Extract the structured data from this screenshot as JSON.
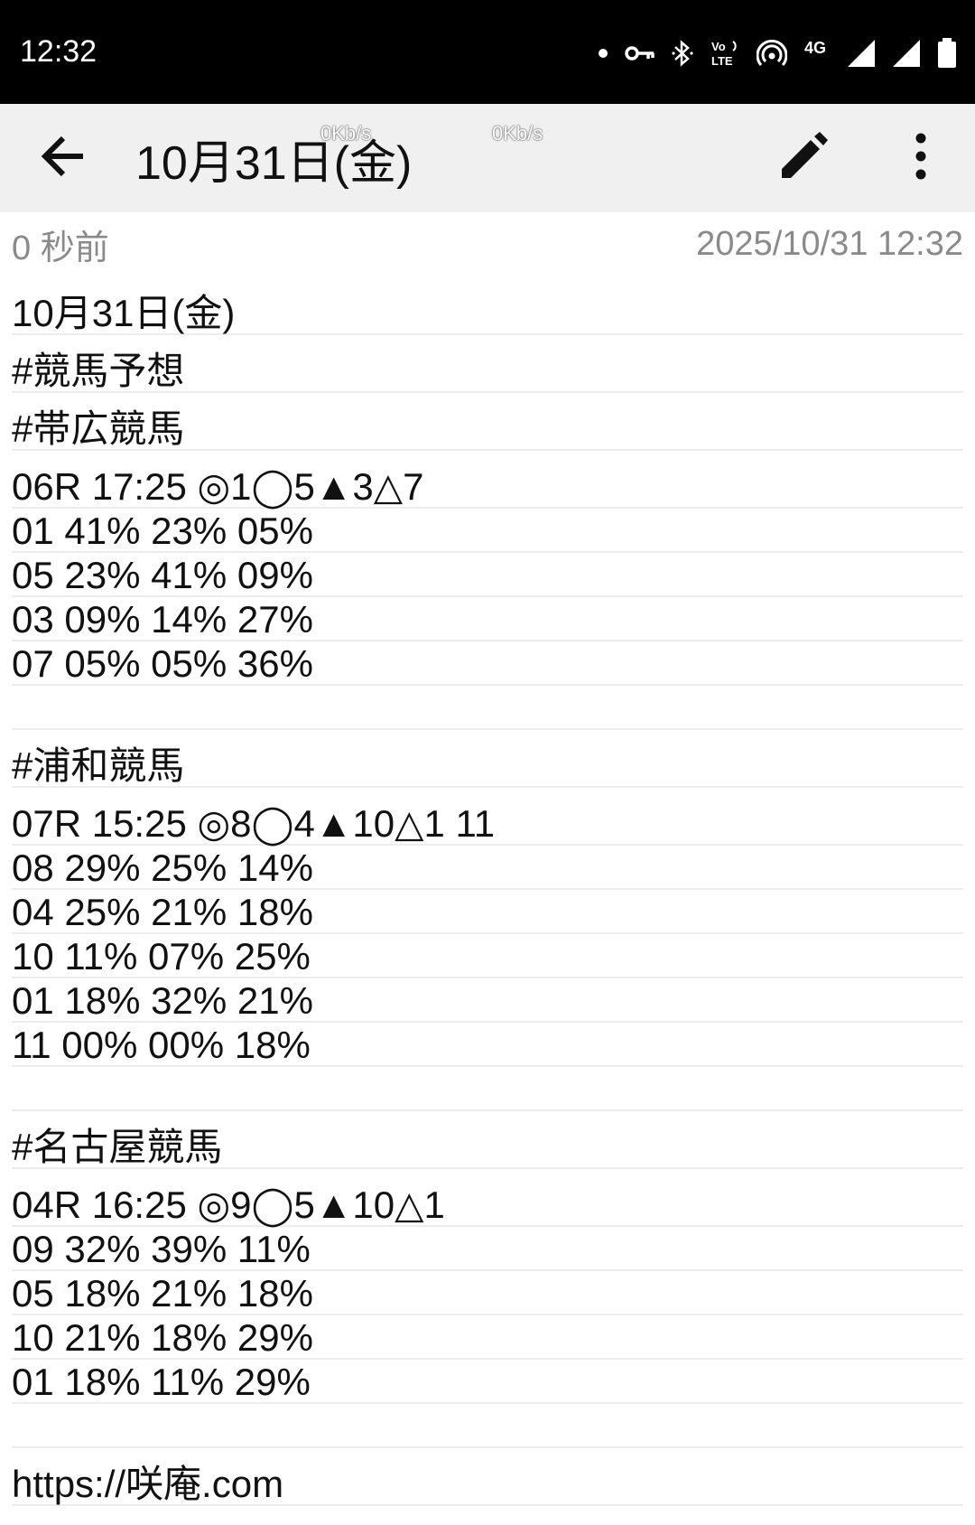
{
  "status_bar": {
    "time": "12:32",
    "icons": [
      "dot-icon",
      "vpn-key-icon",
      "bluetooth-icon",
      "volte-icon",
      "hotspot-icon",
      "4g-icon",
      "signal-icon",
      "signal-icon",
      "battery-icon"
    ],
    "network_label": "4G",
    "volte_label": "Vo LTE"
  },
  "toolbar": {
    "title": "10月31日(金)",
    "net_speed_1": "0Kb/s",
    "net_speed_2": "0Kb/s"
  },
  "meta": {
    "relative_time": "0 秒前",
    "timestamp": "2025/10/31 12:32"
  },
  "lines": [
    "10月31日(金)",
    "#競馬予想",
    "#帯広競馬",
    "06R 17:25 ◎1◯5▲3△7",
    "01 41% 23% 05%",
    "05 23% 41% 09%",
    "03 09% 14% 27%",
    "07 05% 05% 36%",
    "",
    "#浦和競馬",
    "07R 15:25 ◎8◯4▲10△1 11",
    "08 29% 25% 14%",
    "04 25% 21% 18%",
    "10 11% 07% 25%",
    "01 18% 32% 21%",
    "11 00% 00% 18%",
    "",
    "#名古屋競馬",
    "04R 16:25 ◎9◯5▲10△1",
    "09 32% 39% 11%",
    "05 18% 21% 18%",
    "10 21% 18% 29%",
    "01 18% 11% 29%",
    "",
    "https://咲庵.com"
  ]
}
